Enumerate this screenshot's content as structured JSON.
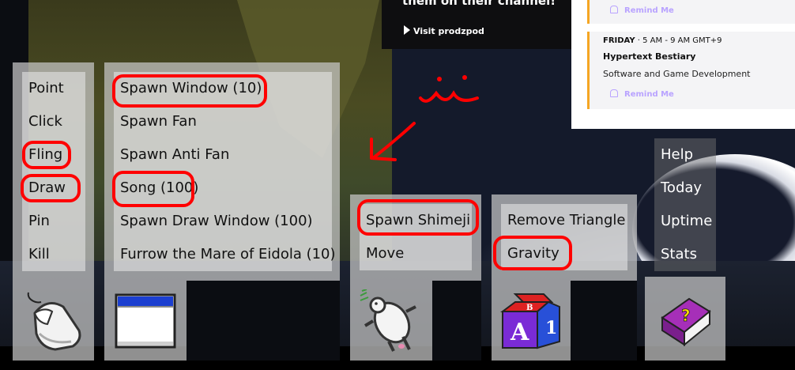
{
  "stream_card": {
    "title": "them on their channel!",
    "visit_label": "Visit prodzpod"
  },
  "schedule": {
    "remind_label": "Remind Me",
    "entry": {
      "day": "FRIDAY",
      "time": "5 AM - 9 AM GMT+9",
      "title": "Hypertext Bestiary",
      "category": "Software and Game Development"
    },
    "accent_color": "#f5a623",
    "remind_color": "#b9a3ff"
  },
  "mouse_menu": {
    "items": [
      "Point",
      "Click",
      "Fling",
      "Draw",
      "Pin",
      "Kill"
    ],
    "icon": "mouse-icon"
  },
  "window_menu": {
    "items": [
      "Spawn Window (10)",
      "Spawn Fan",
      "Spawn Anti Fan",
      "Song (100)",
      "Spawn Draw Window (100)",
      "Furrow the Mare of Eidola (10)"
    ],
    "icon": "window-icon"
  },
  "shimeji_menu": {
    "items": [
      "Spawn Shimeji",
      "Move"
    ],
    "icon": "shimeji-cat-icon"
  },
  "blocks_menu": {
    "items": [
      "Remove Triangle",
      "Gravity"
    ],
    "icon": "abc-blocks-icon"
  },
  "help_menu": {
    "items": [
      "Help",
      "Today",
      "Uptime",
      "Stats"
    ],
    "icon": "help-book-icon"
  },
  "annotation": {
    "scribble": "‿⁔ doodle",
    "marker_color": "#ff0000"
  }
}
